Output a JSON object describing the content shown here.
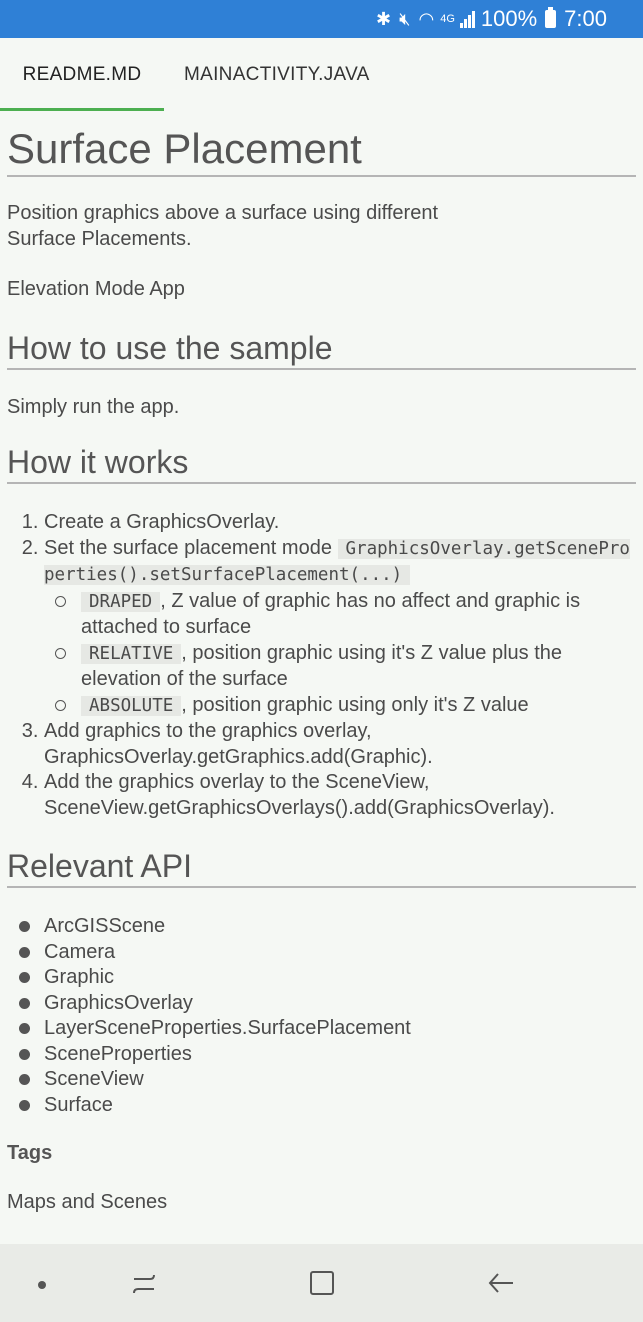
{
  "status_bar": {
    "network": "4G",
    "battery": "100%",
    "time": "7:00"
  },
  "tabs": [
    {
      "label": "README.MD",
      "active": true
    },
    {
      "label": "MAINACTIVITY.JAVA",
      "active": false
    }
  ],
  "readme": {
    "title": "Surface Placement",
    "description": "Position graphics above a surface using different Surface Placements.",
    "image_alt": "Elevation Mode App",
    "how_to_use": {
      "heading": "How to use the sample",
      "text": "Simply run the app."
    },
    "how_it_works": {
      "heading": "How it works",
      "step1": "Create a GraphicsOverlay.",
      "step2_text": "Set the surface placement mode ",
      "step2_code": "GraphicsOverlay.getSceneProperties().setSurfacePlacement(...)",
      "sub": [
        {
          "code": "DRAPED",
          "text": ", Z value of graphic has no affect and graphic is attached to surface"
        },
        {
          "code": "RELATIVE",
          "text": ", position graphic using it's Z value plus the elevation of the surface"
        },
        {
          "code": "ABSOLUTE",
          "text": ", position graphic using only it's Z value"
        }
      ],
      "step3": "Add graphics to the graphics overlay, GraphicsOverlay.getGraphics.add(Graphic).",
      "step4": "Add the graphics overlay to the SceneView, SceneView.getGraphicsOverlays().add(GraphicsOverlay)."
    },
    "relevant_api": {
      "heading": "Relevant API",
      "items": [
        "ArcGISScene",
        "Camera",
        "Graphic",
        "GraphicsOverlay",
        "LayerSceneProperties.SurfacePlacement",
        "SceneProperties",
        "SceneView",
        "Surface"
      ]
    },
    "tags": {
      "heading": "Tags",
      "text": "Maps and Scenes"
    }
  },
  "colors": {
    "status_bar": "#2f80d6",
    "tab_indicator": "#4caf50",
    "background": "#f5f8f4"
  },
  "icons": [
    "bluetooth-icon",
    "mute-icon",
    "wifi-icon",
    "signal-icon",
    "battery-icon",
    "nav-dot-icon",
    "recent-apps-icon",
    "home-icon",
    "back-icon"
  ]
}
